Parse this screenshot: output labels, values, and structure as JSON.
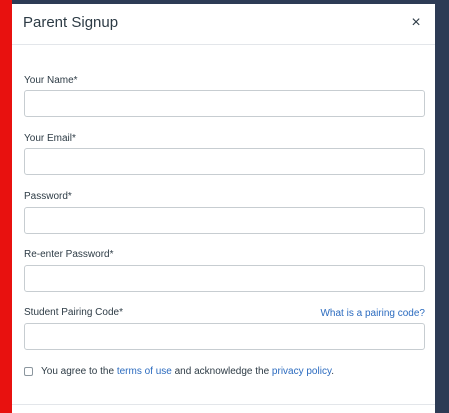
{
  "dialog": {
    "title": "Parent Signup",
    "close_symbol": "×"
  },
  "fields": {
    "name": {
      "label": "Your Name*",
      "value": ""
    },
    "email": {
      "label": "Your Email*",
      "value": ""
    },
    "password": {
      "label": "Password*",
      "value": ""
    },
    "password_confirm": {
      "label": "Re-enter Password*",
      "value": ""
    },
    "pairing_code": {
      "label": "Student Pairing Code*",
      "value": "",
      "help_link": "What is a pairing code?"
    }
  },
  "agreement": {
    "prefix": "You agree to the ",
    "terms_link": "terms of use",
    "middle": " and acknowledge the ",
    "privacy_link": "privacy policy",
    "suffix": ".",
    "checked": false
  },
  "colors": {
    "accent_link": "#2b6bbf",
    "left_background": "#e8110f",
    "right_background": "#2d3b55"
  },
  "icons": {
    "close": "close-icon"
  }
}
